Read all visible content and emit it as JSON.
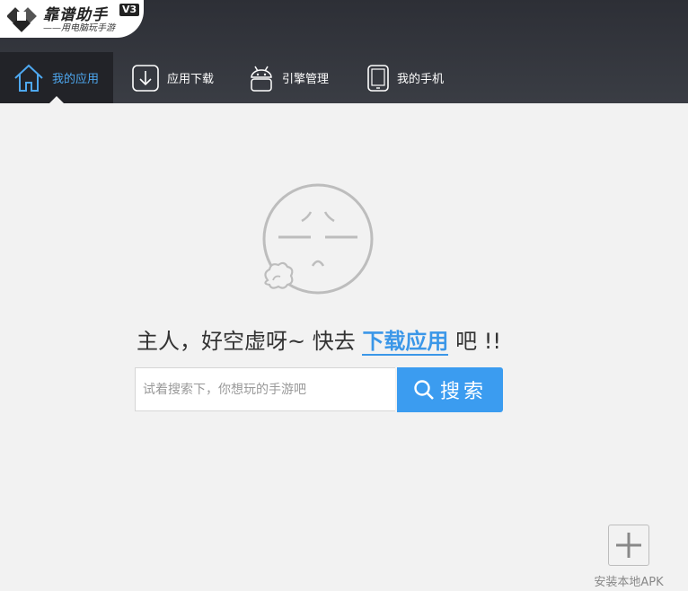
{
  "brand": {
    "name": "靠谱助手",
    "version": "V3",
    "slogan": "——用电脑玩手游"
  },
  "nav": {
    "items": [
      {
        "label": "我的应用",
        "icon": "home-icon",
        "active": true
      },
      {
        "label": "应用下载",
        "icon": "download-icon",
        "active": false
      },
      {
        "label": "引擎管理",
        "icon": "android-icon",
        "active": false
      },
      {
        "label": "我的手机",
        "icon": "phone-icon",
        "active": false
      }
    ]
  },
  "empty_state": {
    "icon": "sad-face-icon",
    "message_prefix": "主人，好空虚呀~ 快去",
    "link_text": "下载应用",
    "message_suffix": "吧 !!"
  },
  "search": {
    "placeholder": "试着搜索下，你想玩的手游吧",
    "value": "",
    "button_label": "搜索"
  },
  "install_apk": {
    "label": "安装本地APK"
  },
  "colors": {
    "accent": "#3b9cf0",
    "header_bg": "#33353c",
    "active_tab_bg": "#222328",
    "page_bg": "#f2f2f2"
  }
}
